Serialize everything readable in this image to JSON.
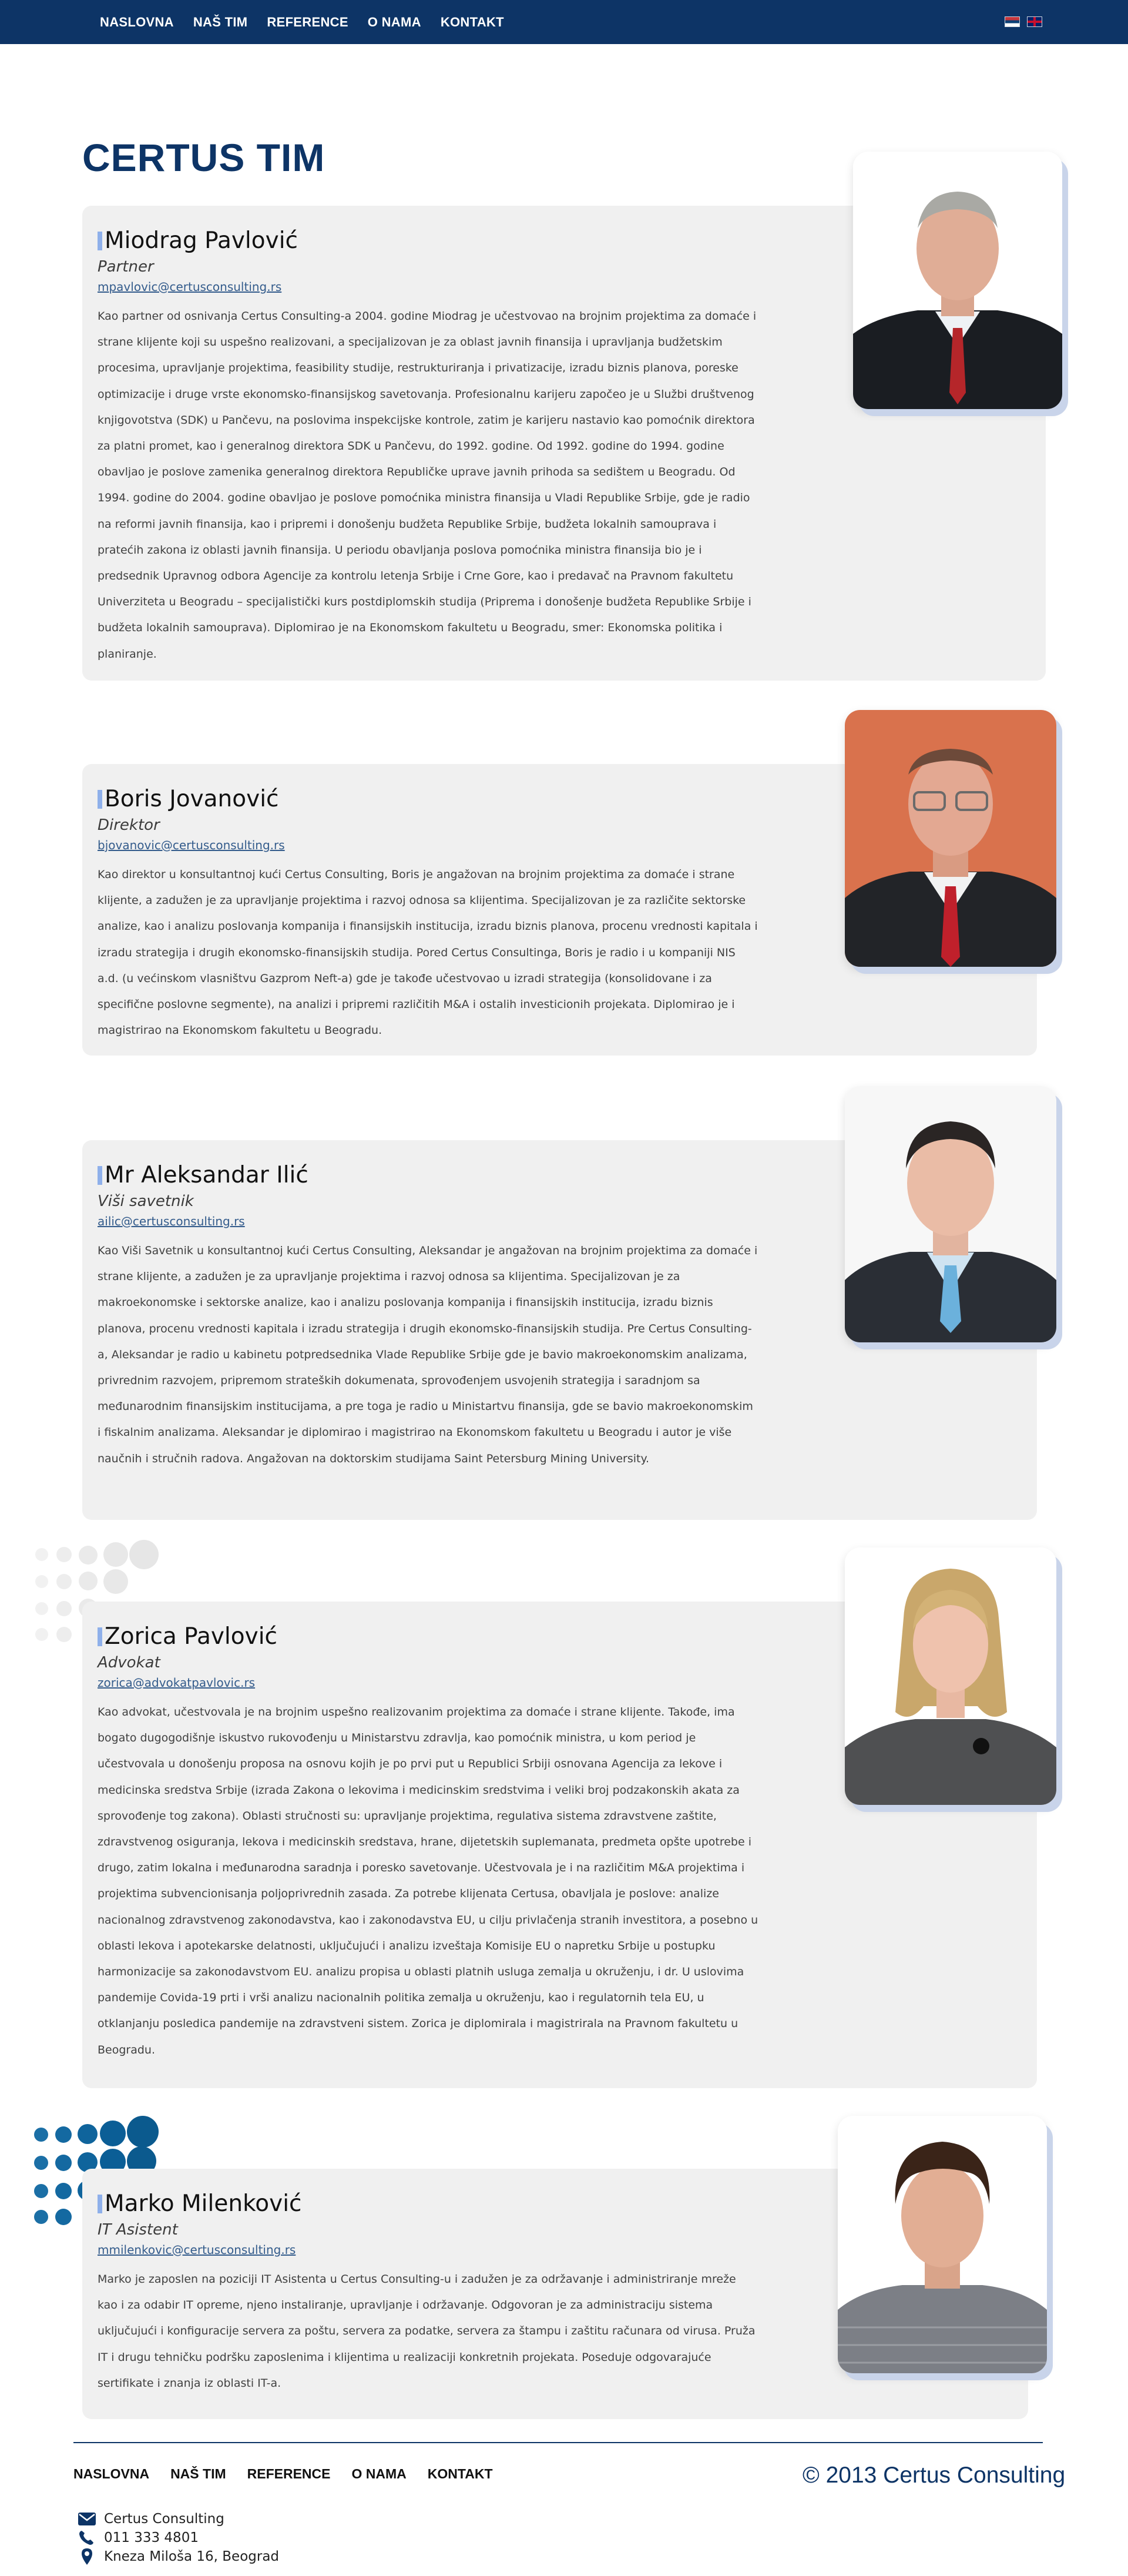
{
  "nav": {
    "items": [
      "NASLOVNA",
      "NAŠ TIM",
      "REFERENCE",
      "O NAMA",
      "KONTAKT"
    ],
    "languages": [
      "Srpski",
      "English"
    ]
  },
  "page": {
    "title": "CERTUS TIM"
  },
  "team": [
    {
      "name": "Miodrag Pavlović",
      "role": "Partner",
      "email": "mpavlovic@certusconsulting.rs",
      "bio": "Kao partner od osnivanja Certus Consulting-a 2004. godine Miodrag je učestvovao na brojnim projektima za domaće i strane klijente koji su uspešno realizovani, a specijalizovan je za oblast javnih finansija i upravljanja budžetskim procesima, upravljanje projektima, feasibility studije, restrukturiranja i privatizacije, izradu biznis planova, poreske optimizacije i druge vrste ekonomsko-finansijskog savetovanja. Profesionalnu karijeru započeo je u Službi društvenog knjigovotstva (SDK) u Pančevu, na poslovima inspekcijske kontrole, zatim je karijeru nastavio kao pomoćnik direktora za platni promet, kao i generalnog direktora SDK u Pančevu, do 1992. godine. Od 1992. godine do 1994. godine obavljao je poslove zamenika generalnog direktora Republičke uprave javnih prihoda sa sedištem u Beogradu. Od 1994. godine do 2004. godine obavljao je poslove pomoćnika ministra finansija u Vladi Republike Srbije, gde je radio na reformi javnih finansija, kao i pripremi i donošenju budžeta Republike Srbije, budžeta lokalnih samouprava i pratećih zakona iz oblasti javnih finansija. U periodu obavljanja poslova pomoćnika ministra finansija bio je i predsednik Upravnog odbora Agencije za kontrolu letenja Srbije i Crne Gore, kao i predavač na Pravnom fakultetu Univerziteta u Beogradu – specijalistički kurs postdiplomskih studija (Priprema i donošenje budžeta Republike Srbije i budžeta lokalnih samouprava). Diplomirao je na Ekonomskom fakultetu u Beogradu, smer: Ekonomska politika i planiranje."
    },
    {
      "name": "Boris Jovanović",
      "role": "Direktor",
      "email": "bjovanovic@certusconsulting.rs",
      "bio": "Kao direktor u konsultantnoj kući Certus Consulting, Boris je angažovan na brojnim projektima za domaće i strane klijente, a zadužen je za upravljanje projektima i razvoj odnosa sa klijentima. Specijalizovan je za različite sektorske analize, kao i analizu poslovanja kompanija i finansijskih institucija, izradu biznis planova, procenu vrednosti kapitala i izradu strategija i drugih ekonomsko-finansijskih studija. Pored Certus Consultinga, Boris je radio i u kompaniji NIS a.d. (u većinskom vlasništvu Gazprom Neft-a) gde je takođe učestvovao u izradi strategija (konsolidovane i za specifične poslovne segmente), na analizi i pripremi različitih M&A i ostalih investicionih projekata. Diplomirao je i magistrirao na Ekonomskom fakultetu u Beogradu."
    },
    {
      "name": "Mr Aleksandar Ilić",
      "role": "Viši savetnik",
      "email": "ailic@certusconsulting.rs",
      "bio": "Kao Viši Savetnik u konsultantnoj kući Certus Consulting, Aleksandar je angažovan na brojnim projektima za domaće i strane klijente, a zadužen je za upravljanje projektima i razvoj odnosa sa klijentima. Specijalizovan je za makroekonomske i sektorske analize, kao i analizu poslovanja kompanija i finansijskih institucija, izradu biznis planova, procenu vrednosti kapitala i izradu strategija i drugih ekonomsko-finansijskih studija. Pre Certus Consulting-a, Aleksandar je radio u kabinetu potpredsednika Vlade Republike Srbije gde je bavio makroekonomskim analizama, privrednim razvojem, pripremom strateških dokumenata, sprovođenjem usvojenih strategija i saradnjom sa međunarodnim finansijskim institucijama, a pre toga je radio u Ministartvu finansija, gde se bavio makroekonomskim i fiskalnim analizama. Aleksandar je diplomirao i magistrirao na Ekonomskom fakultetu u Beogradu i autor je više naučnih i stručnih radova. Angažovan na doktorskim studijama Saint Petersburg Mining University."
    },
    {
      "name": "Zorica Pavlović",
      "role": "Advokat",
      "email": "zorica@advokatpavlovic.rs",
      "bio": "Kao advokat, učestvovala je na brojnim uspešno realizovanim projektima za domaće i strane klijente. Takođe, ima bogato dugogodišnje iskustvo rukovođenju u Ministarstvu zdravlja, kao pomoćnik ministra, u kom period je učestvovala u donošenju proposa na osnovu kojih je po prvi put u Republici Srbiji osnovana Agencija za lekove i medicinska sredstva Srbije (izrada Zakona o lekovima i medicinskim sredstvima i veliki broj podzakonskih akata za sprovođenje tog zakona). Oblasti stručnosti su: upravljanje projektima, regulativa sistema zdravstvene zaštite, zdravstvenog osiguranja, lekova i medicinskih sredstava, hrane, dijetetskih suplemanata, predmeta opšte upotrebe i drugo, zatim lokalna i međunarodna saradnja i poresko savetovanje. Učestvovala je i na različitim M&A projektima i projektima subvencionisanja poljoprivrednih zasada. Za potrebe klijenata Certusa, obavljala je poslove: analize nacionalnog zdravstvenog zakonodavstva, kao i zakonodavstva EU, u cilju privlačenja stranih investitora, a posebno u oblasti lekova i apotekarske delatnosti, uključujući i analizu izveštaja Komisije EU o napretku Srbije u postupku harmonizacije sa zakonodavstvom EU. analizu propisa u oblasti platnih usluga zemalja u okruženju, i dr. U uslovima pandemije Covida-19 prti i vrši analizu nacionalnih politika zemalja u okruženju, kao i regulatornih tela EU, u otklanjanju posledica pandemije na zdravstveni sistem. Zorica je diplomirala i magistrirala na Pravnom fakultetu u Beogradu."
    },
    {
      "name": "Marko Milenković",
      "role": "IT Asistent",
      "email": "mmilenkovic@certusconsulting.rs",
      "bio": "Marko je zaposlen na poziciji IT Asistenta u Certus Consulting-u i zadužen je za održavanje i administriranje mreže kao i za odabir IT opreme, njeno instaliranje, upravljanje i održavanje. Odgovoran je za administraciju sistema uključujući i konfiguracije servera za poštu, servera za podatke, servera za štampu i zaštitu računara od virusa. Pruža IT i drugu tehničku podršku zaposlenima i klijentima u realizaciji konkretnih projekata. Poseduje odgovarajuće sertifikate i znanja iz oblasti IT-a."
    }
  ],
  "footer": {
    "nav": [
      "NASLOVNA",
      "NAŠ TIM",
      "REFERENCE",
      "O NAMA",
      "KONTAKT"
    ],
    "copyright": "© 2013 Certus Consulting",
    "contact": {
      "email_label": "Certus Consulting",
      "phone": "011 333 4801",
      "address": "Kneza Miloša 16, Beograd"
    }
  },
  "colors": {
    "brand": "#0d3466",
    "card_bg": "#f0f0f0",
    "accent": "#8fb0ea",
    "dots": "#0b5a8e"
  },
  "icons": [
    "envelope-icon",
    "phone-icon",
    "location-pin-icon",
    "flag-rs-icon",
    "flag-gb-icon"
  ]
}
